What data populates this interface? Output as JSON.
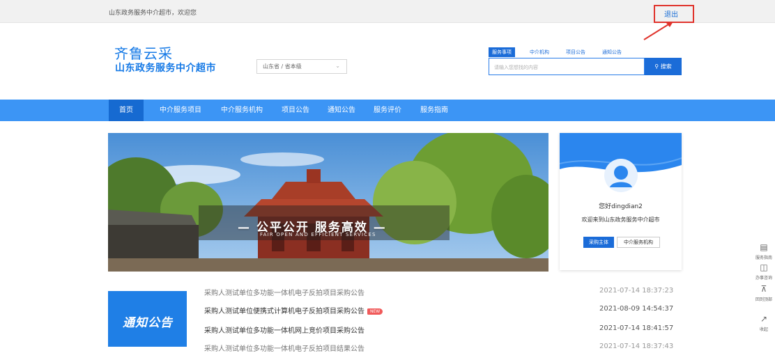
{
  "topbar": {
    "welcome": "山东政务服务中介超市，欢迎您",
    "logout": "退出"
  },
  "logo": {
    "title": "齐鲁云采",
    "subtitle": "山东政务服务中介超市"
  },
  "region": {
    "value": "山东省 / 省本级"
  },
  "search": {
    "tabs": [
      "服务事项",
      "中介机构",
      "项目公告",
      "通知公告"
    ],
    "active_tab": "服务事项",
    "placeholder": "请输入您想找的内容",
    "button": "搜索"
  },
  "nav": {
    "items": [
      "首页",
      "中介服务项目",
      "中介服务机构",
      "项目公告",
      "通知公告",
      "服务评价",
      "服务指南"
    ],
    "active": "首页"
  },
  "banner": {
    "slogan": "— 公平公开  服务高效 —",
    "slogan_en": "FAIR OPEN AND EFFICIENT SERVICES"
  },
  "user_card": {
    "greeting": "您好dingdian2",
    "welcome": "欢迎来到山东政务服务中介超市",
    "btn_primary": "采购主体",
    "btn_secondary": "中介服务机构"
  },
  "notices": {
    "title": "通知公告",
    "items": [
      {
        "text": "采购人测试单位多功能一体机电子反拍项目采购公告",
        "date": "2021-07-14 18:37:23",
        "new": false
      },
      {
        "text": "采购人测试单位便携式计算机电子反拍项目采购公告",
        "date": "2021-08-09 14:54:37",
        "new": true
      },
      {
        "text": "采购人测试单位多功能一体机网上竞价项目采购公告",
        "date": "2021-07-14 18:41:57",
        "new": false
      },
      {
        "text": "采购人测试单位多功能一体机电子反拍项目结果公告",
        "date": "2021-07-14 18:37:43",
        "new": false
      }
    ],
    "new_label": "NEW"
  },
  "right_tools": [
    {
      "label": "服务指南",
      "icon": "search-doc-icon"
    },
    {
      "label": "办事咨询",
      "icon": "consult-icon"
    },
    {
      "label": "回到顶部",
      "icon": "back-to-top-icon"
    },
    {
      "label": "收起",
      "icon": "collapse-icon"
    }
  ],
  "colors": {
    "brand_blue": "#1579e6",
    "nav_blue": "#3c95f5",
    "nav_active": "#166ad1",
    "highlight_red": "#e0332c",
    "new_tag": "#f05a5a"
  }
}
